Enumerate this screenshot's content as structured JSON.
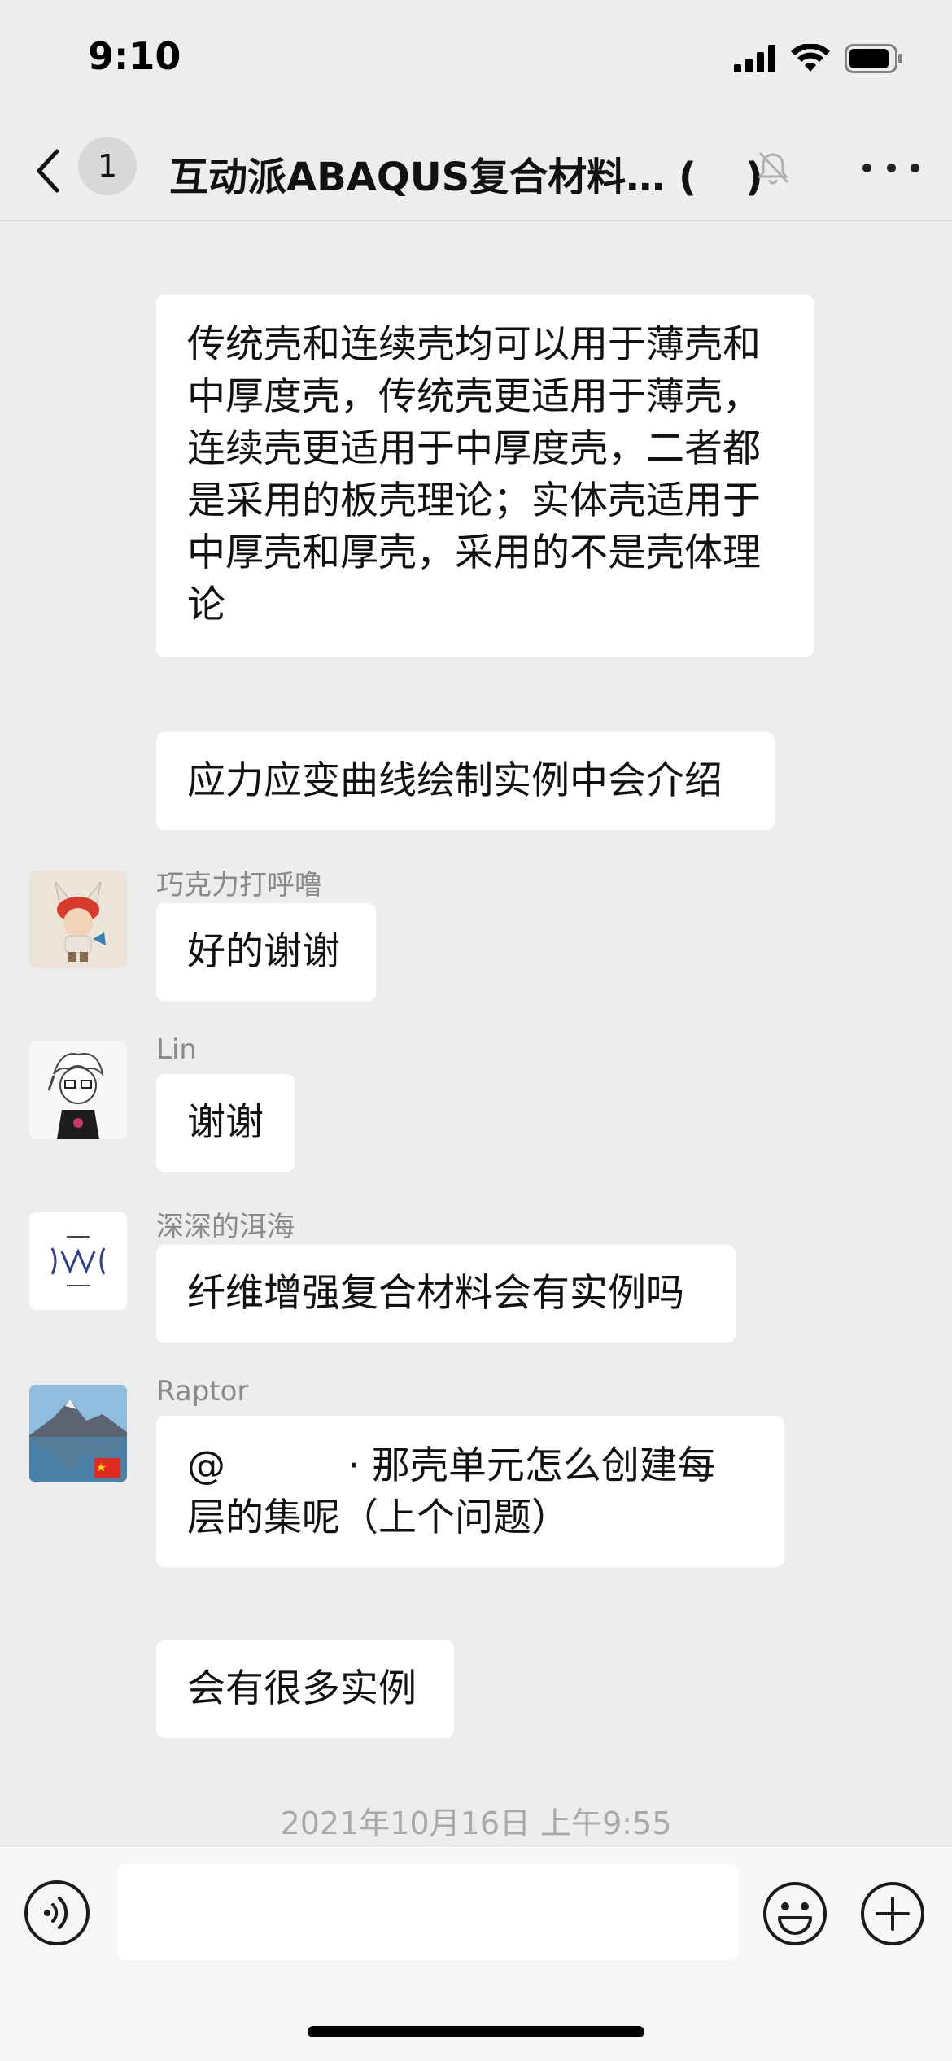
{
  "status_bar": {
    "time": "9:10"
  },
  "header": {
    "unread_count": "1",
    "title": "互动派ABAQUS复合材料… (",
    "title_close": ")"
  },
  "messages": [
    {
      "text": "传统壳和连续壳均可以用于薄壳和中厚度壳，传统壳更适用于薄壳，连续壳更适用于中厚度壳，二者都是采用的板壳理论；实体壳适用于中厚壳和厚壳，采用的不是壳体理论"
    },
    {
      "text": "应力应变曲线绘制实例中会介绍"
    },
    {
      "sender": "巧克力打呼噜",
      "text": "好的谢谢"
    },
    {
      "sender": "Lin",
      "text": "谢谢"
    },
    {
      "sender": "深深的洱海",
      "text": "纤维增强复合材料会有实例吗"
    },
    {
      "sender": "Raptor",
      "text_prefix": "@",
      "text": "· 那壳单元怎么创建每层的集呢（上个问题）"
    },
    {
      "text": "会有很多实例"
    }
  ],
  "timestamp": "2021年10月16日 上午9:55",
  "input": {
    "placeholder": ""
  },
  "icons": {
    "back": "chevron-left-icon",
    "mute": "bell-slash-icon",
    "more": "more-dots-icon",
    "voice": "voice-icon",
    "emoji": "emoji-icon",
    "plus": "plus-icon"
  },
  "colors": {
    "bubble": "#ffffff",
    "background": "#ededed",
    "name": "#8a8a8a"
  }
}
